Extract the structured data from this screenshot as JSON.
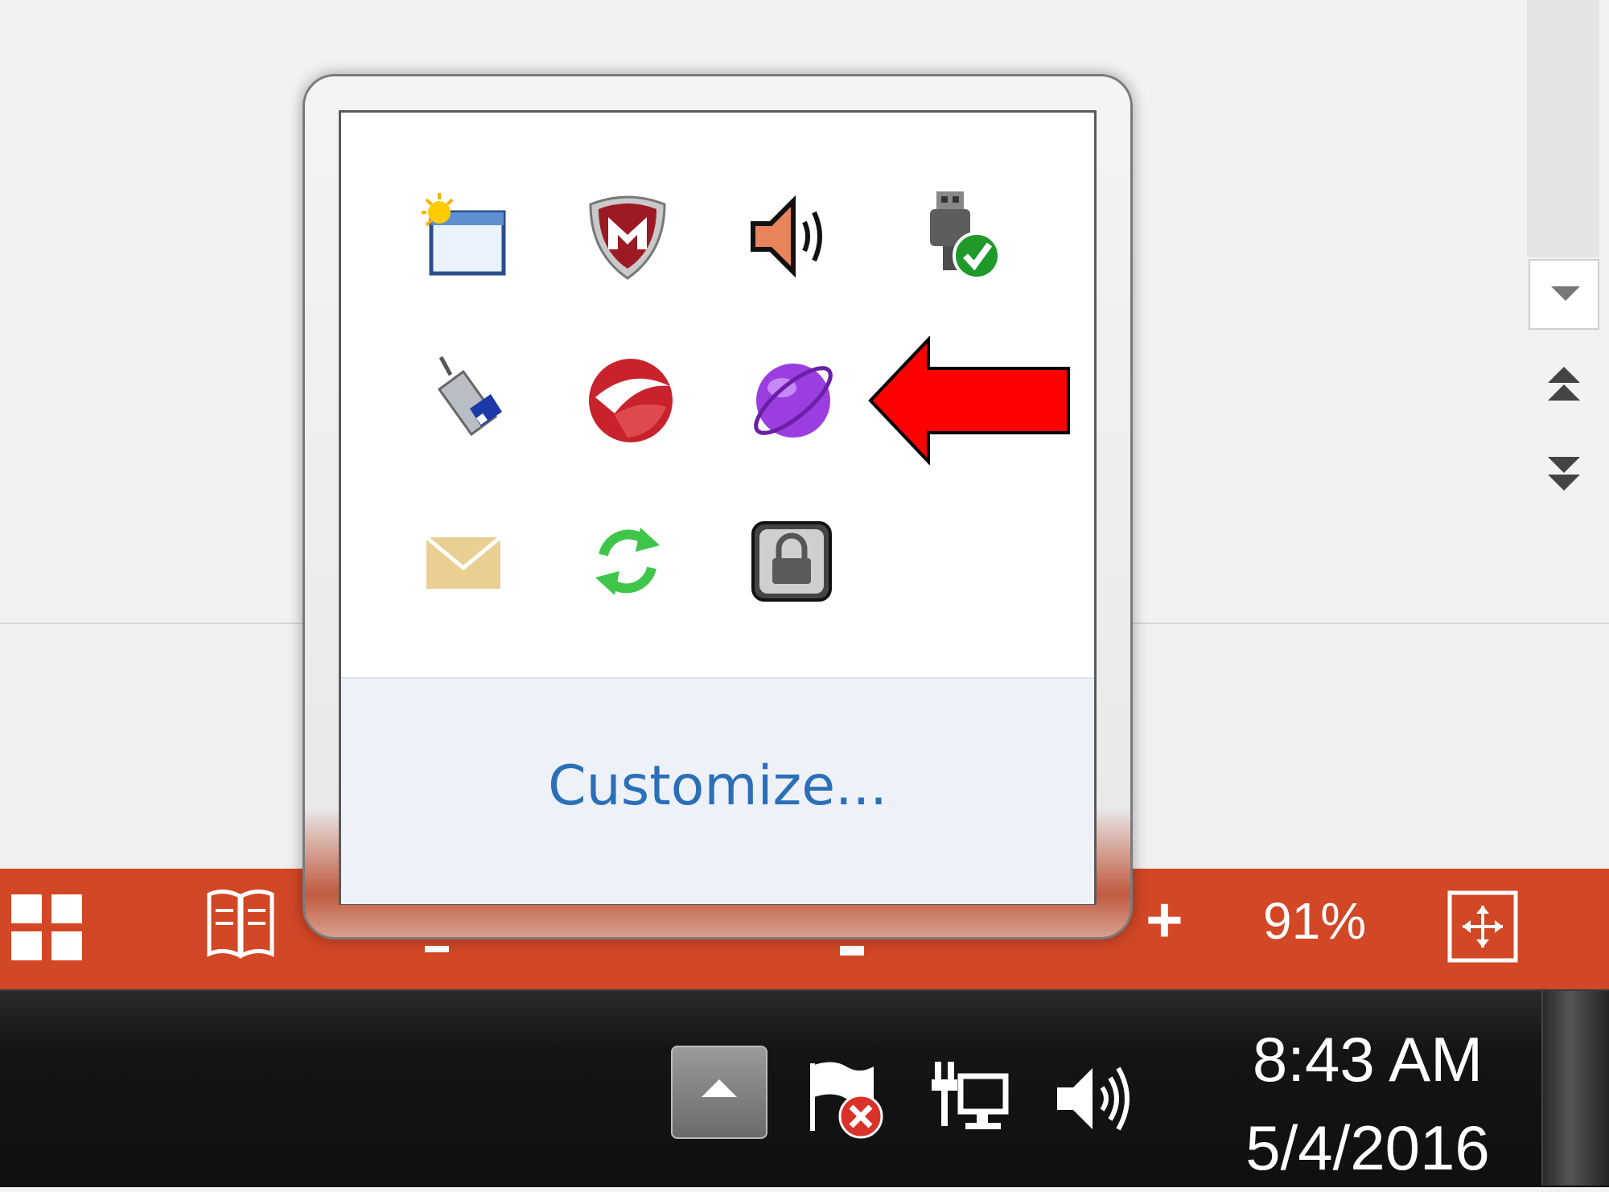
{
  "app": {
    "statusbar": {
      "zoom_plus": "+",
      "zoom_percent": "91%"
    }
  },
  "flyout": {
    "customize_label": "Customize...",
    "icons": [
      "window-sun-icon",
      "mcafee-shield-icon",
      "speaker-icon",
      "usb-safe-remove-icon",
      "usb-drive-icon",
      "red-orb-icon",
      "purple-globe-icon",
      "mail-envelope-icon",
      "sync-arrows-icon",
      "lock-icon"
    ]
  },
  "taskbar": {
    "clock_time": "8:43 AM",
    "clock_date": "5/4/2016",
    "tray_icons": [
      "show-hidden-icons-button",
      "action-center-flag-icon",
      "network-icon",
      "volume-icon"
    ]
  },
  "colors": {
    "statusbar": "#d24726",
    "taskbar": "#141414",
    "link": "#2a6fb8",
    "arrow": "#ff0000"
  }
}
